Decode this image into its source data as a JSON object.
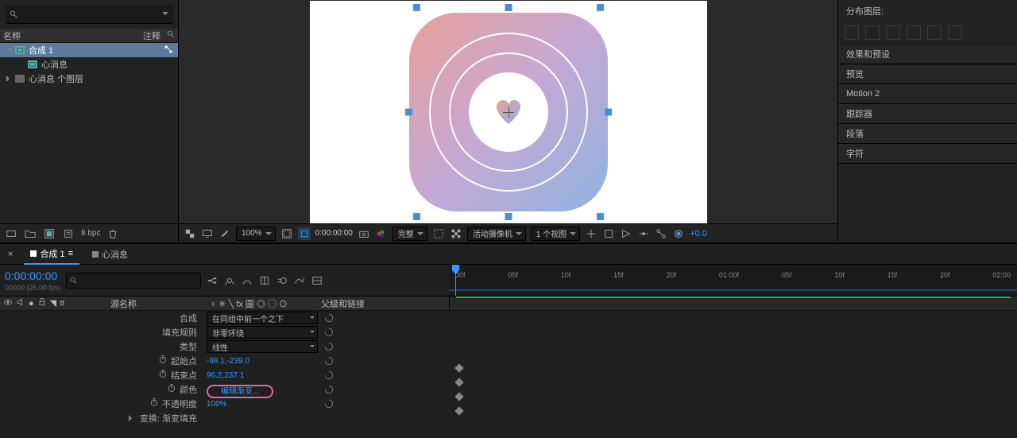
{
  "project": {
    "search_placeholder": "",
    "col_name": "名称",
    "col_comment": "注释",
    "items": [
      {
        "label": "合成 1",
        "type": "comp",
        "selected": true,
        "depth": 0,
        "expand": true
      },
      {
        "label": "心消息",
        "type": "comp",
        "selected": false,
        "depth": 1
      },
      {
        "label": "心消息 个图层",
        "type": "folder",
        "selected": false,
        "depth": 0,
        "caret": true
      }
    ],
    "bpc": "8 bpc"
  },
  "viewer": {
    "zoom": "100%",
    "timecode": "0:00:00:00",
    "quality": "完整",
    "camera": "活动摄像机",
    "views": "1 个视图",
    "exposure": "+0.0"
  },
  "side": {
    "distrib_title": "分布图层:",
    "panels": [
      "效果和预设",
      "预览",
      "Motion 2",
      "跟踪器",
      "段落",
      "字符"
    ]
  },
  "timeline": {
    "tabs": [
      {
        "label": "合成 1",
        "active": true
      },
      {
        "label": "心消息",
        "active": false
      }
    ],
    "current_time": "0:00:00:00",
    "fps_label": "00000 (25.00 fps)",
    "col_source": "源名称",
    "col_switches": "♀ ✳ ╲ fx 圖 ◎ ◯ ⊙",
    "col_parent": "父级和链接",
    "ruler": [
      "00f",
      "05f",
      "10f",
      "15f",
      "20f",
      "01:00f",
      "05f",
      "10f",
      "15f",
      "20f",
      "02:00"
    ],
    "props": [
      {
        "label": "合成",
        "type": "select",
        "value": "在同组中前一个之下"
      },
      {
        "label": "填充规则",
        "type": "select",
        "value": "非零环绕"
      },
      {
        "label": "类型",
        "type": "select",
        "value": "线性"
      },
      {
        "label": "起始点",
        "type": "value",
        "value": "-98.1,-239.0",
        "stopwatch": true,
        "kf": true
      },
      {
        "label": "结束点",
        "type": "value",
        "value": "96.2,237.1",
        "stopwatch": true,
        "kf": true
      },
      {
        "label": "颜色",
        "type": "grad",
        "value": "编辑渐变...",
        "stopwatch": true,
        "kf": true,
        "highlight": true
      },
      {
        "label": "不透明度",
        "type": "value",
        "value": "100%",
        "stopwatch": true,
        "kf": true
      }
    ],
    "transform_group": "变换: 渐变填充"
  }
}
